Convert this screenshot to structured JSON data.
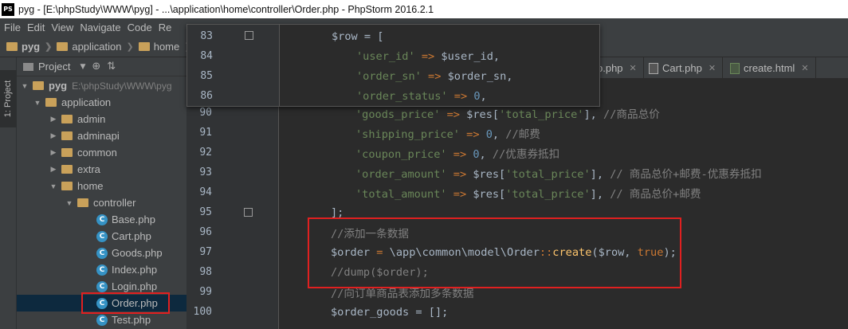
{
  "window": {
    "app_icon": "PS",
    "title": "pyg - [E:\\phpStudy\\WWW\\pyg] - ...\\application\\home\\controller\\Order.php - PhpStorm 2016.2.1"
  },
  "menu": {
    "file": "File",
    "edit": "Edit",
    "view": "View",
    "navigate": "Navigate",
    "code": "Code",
    "refactor_partial": "Re"
  },
  "breadcrumb": {
    "items": [
      "pyg",
      "application",
      "home"
    ]
  },
  "toolstrip": {
    "project_tab": "1: Project"
  },
  "project_panel": {
    "title": "Project",
    "tree": [
      {
        "label": "pyg",
        "path": "E:\\phpStudy\\WWW\\pyg",
        "type": "folder",
        "expanded": true
      },
      {
        "label": "application",
        "type": "folder",
        "expanded": true
      },
      {
        "label": "admin",
        "type": "folder",
        "expanded": false
      },
      {
        "label": "adminapi",
        "type": "folder",
        "expanded": false
      },
      {
        "label": "common",
        "type": "folder",
        "expanded": false
      },
      {
        "label": "extra",
        "type": "folder",
        "expanded": false
      },
      {
        "label": "home",
        "type": "folder",
        "expanded": true
      },
      {
        "label": "controller",
        "type": "folder",
        "expanded": true
      },
      {
        "label": "Base.php",
        "type": "php-class"
      },
      {
        "label": "Cart.php",
        "type": "php-class"
      },
      {
        "label": "Goods.php",
        "type": "php-class"
      },
      {
        "label": "Index.php",
        "type": "php-class"
      },
      {
        "label": "Login.php",
        "type": "php-class"
      },
      {
        "label": "Order.php",
        "type": "php-class",
        "selected": true
      },
      {
        "label": "Test.php",
        "type": "php-class"
      }
    ]
  },
  "tabs": [
    {
      "label": "p.php",
      "icon": "php-file-icon"
    },
    {
      "label": "Cart.php",
      "icon": "php-file-icon"
    },
    {
      "label": "create.html",
      "icon": "html-file-icon"
    }
  ],
  "popup_lines": [
    {
      "num": "83",
      "code": "$row = ["
    },
    {
      "num": "84",
      "code": "'user_id' => $user_id,"
    },
    {
      "num": "85",
      "code": "'order_sn' => $order_sn,"
    },
    {
      "num": "86",
      "code": "'order_status' => 0,"
    }
  ],
  "editor_lines": [
    {
      "num": "90",
      "code": "'goods_price' => $res['total_price'], //商品总价"
    },
    {
      "num": "91",
      "code": "'shipping_price' => 0, //邮费"
    },
    {
      "num": "92",
      "code": "'coupon_price' => 0, //优惠券抵扣"
    },
    {
      "num": "93",
      "code": "'order_amount' => $res['total_price'], // 商品总价+邮费-优惠券抵扣"
    },
    {
      "num": "94",
      "code": "'total_amount' => $res['total_price'], // 商品总价+邮费"
    },
    {
      "num": "95",
      "code": "];"
    },
    {
      "num": "96",
      "code": "//添加一条数据"
    },
    {
      "num": "97",
      "code": "$order = \\app\\common\\model\\Order::create($row, true);"
    },
    {
      "num": "98",
      "code": "//dump($order);"
    },
    {
      "num": "99",
      "code": "//向订单商品表添加多条数据"
    },
    {
      "num": "100",
      "code": "$order_goods = [];"
    }
  ],
  "colors": {
    "highlight_box": "#e02020",
    "string": "#6a8759",
    "keyword": "#cc7832",
    "number": "#6897bb",
    "comment": "#808080",
    "function": "#ffc66d"
  }
}
